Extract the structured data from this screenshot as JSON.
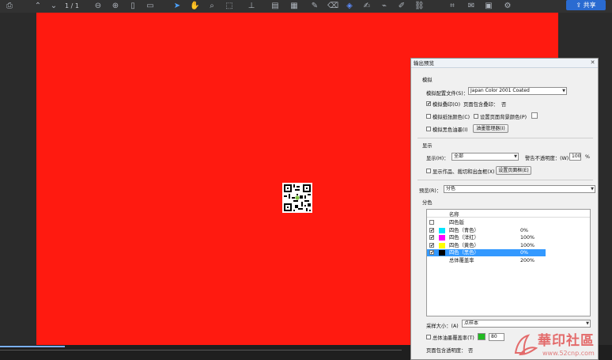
{
  "toolbar": {
    "page_indicator": "1 / 1",
    "share_label": "共享",
    "icons": [
      "print-icon",
      "up-arrow-icon",
      "down-arrow-icon",
      "zoom-out-icon",
      "zoom-in-icon",
      "page-icon",
      "pages-icon",
      "select-arrow-icon",
      "hand-icon",
      "zoom-icon",
      "marquee-icon",
      "stamp-icon",
      "measure-icon",
      "document-icon",
      "pen-icon",
      "eraser-icon",
      "color-icon",
      "sign-icon",
      "highlight-icon",
      "edit-icon",
      "link-icon",
      "crop-icon",
      "mail-icon",
      "image-icon",
      "tools-icon"
    ]
  },
  "dialog": {
    "title": "输出预览",
    "simulation_section": "模拟",
    "profile_label": "模拟配置文件(S)：",
    "profile_value": "Japan Color 2001 Coated",
    "overprint_label": "模拟叠印(O)",
    "overprint_checked": "✔",
    "page_overprint_label": "页面包含叠印：",
    "page_overprint_value": "否",
    "paper_color_label": "模拟纸张颜色(C)",
    "bg_color_label": "设置页面背景颜色(P)",
    "black_ink_label": "模拟黑色油墨(I)",
    "ink_manager_button": "油墨管理器(I)",
    "display_section": "显示",
    "show_label": "显示(H)：",
    "show_value": "全部",
    "warning_opacity_label": "警告不透明度：(W)",
    "warning_opacity_value": "100",
    "percent": "%",
    "art_trim_label": "显示作品、裁切和出血框(X)",
    "page_box_button": "设置页面框(E)",
    "preview_label": "预览(R)：",
    "preview_value": "分色",
    "separations_section": "分色",
    "list_header_name": "名称",
    "separations": [
      {
        "name": "四色版",
        "value": "",
        "checked": "",
        "color": "",
        "selected": false
      },
      {
        "name": "四色（青色）",
        "value": "0%",
        "checked": "✔",
        "color": "#00e5ff",
        "selected": false
      },
      {
        "name": "四色（洋红）",
        "value": "100%",
        "checked": "✔",
        "color": "#ff00ff",
        "selected": false
      },
      {
        "name": "四色（黄色）",
        "value": "100%",
        "checked": "✔",
        "color": "#ffff00",
        "selected": false
      },
      {
        "name": "四色（黑色）",
        "value": "0%",
        "checked": "✔",
        "color": "#000000",
        "selected": true
      },
      {
        "name": "总体覆盖率",
        "value": "200%",
        "checked": "",
        "color": "",
        "selected": false
      }
    ],
    "sample_size_label": "采样大小：(A)",
    "sample_size_value": "点样本",
    "total_coverage_label": "总体油墨覆盖率(T)",
    "total_coverage_value": "80",
    "total_coverage_color": "#22bb22",
    "page_transparency_label": "页面包含透明度：",
    "page_transparency_value": "否"
  },
  "watermark": {
    "text": "華印社區",
    "url": "www.52cnp.com"
  },
  "colors": {
    "page_red": "#ff1a10",
    "selection_blue": "#3399ff",
    "share_blue": "#2a6bd1"
  }
}
